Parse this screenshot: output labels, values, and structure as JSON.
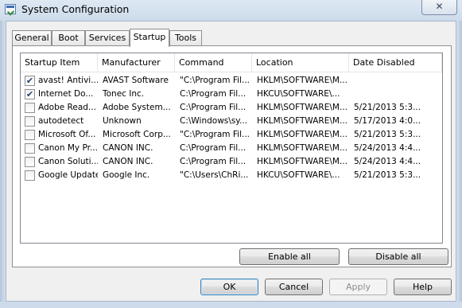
{
  "window": {
    "title": "System Configuration",
    "close_glyph": "✕"
  },
  "tabs": [
    {
      "label": "General",
      "active": false
    },
    {
      "label": "Boot",
      "active": false
    },
    {
      "label": "Services",
      "active": false
    },
    {
      "label": "Startup",
      "active": true
    },
    {
      "label": "Tools",
      "active": false
    }
  ],
  "table": {
    "columns": [
      "Startup Item",
      "Manufacturer",
      "Command",
      "Location",
      "Date Disabled"
    ],
    "rows": [
      {
        "checked": true,
        "item": "avast! Antivi...",
        "manufacturer": "AVAST Software",
        "command": "\"C:\\Program Fil...",
        "location": "HKLM\\SOFTWARE\\M...",
        "date": ""
      },
      {
        "checked": true,
        "item": "Internet Do...",
        "manufacturer": "Tonec Inc.",
        "command": "C:\\Program Fil...",
        "location": "HKCU\\SOFTWARE\\...",
        "date": ""
      },
      {
        "checked": false,
        "item": "Adobe Read...",
        "manufacturer": "Adobe System...",
        "command": "C:\\Program Fil...",
        "location": "HKLM\\SOFTWARE\\M...",
        "date": "5/21/2013 5:3..."
      },
      {
        "checked": false,
        "item": "autodetect",
        "manufacturer": "Unknown",
        "command": "C:\\Windows\\sy...",
        "location": "HKLM\\SOFTWARE\\M...",
        "date": "5/17/2013 4:0..."
      },
      {
        "checked": false,
        "item": "Microsoft Of...",
        "manufacturer": "Microsoft Corp...",
        "command": "\"C:\\Program Fil...",
        "location": "HKLM\\SOFTWARE\\M...",
        "date": "5/21/2013 5:3..."
      },
      {
        "checked": false,
        "item": "Canon My Pr...",
        "manufacturer": "CANON INC.",
        "command": "C:\\Program Fil...",
        "location": "HKLM\\SOFTWARE\\M...",
        "date": "5/24/2013 4:4..."
      },
      {
        "checked": false,
        "item": "Canon Soluti...",
        "manufacturer": "CANON INC.",
        "command": "C:\\Program Fil...",
        "location": "HKLM\\SOFTWARE\\M...",
        "date": "5/24/2013 4:4..."
      },
      {
        "checked": false,
        "item": "Google Update",
        "manufacturer": "Google Inc.",
        "command": "\"C:\\Users\\ChRi...",
        "location": "HKCU\\SOFTWARE\\...",
        "date": "5/21/2013 5:3..."
      }
    ]
  },
  "panel_buttons": {
    "enable_all": "Enable all",
    "disable_all": "Disable all"
  },
  "dialog_buttons": {
    "ok": "OK",
    "cancel": "Cancel",
    "apply": "Apply",
    "help": "Help"
  }
}
